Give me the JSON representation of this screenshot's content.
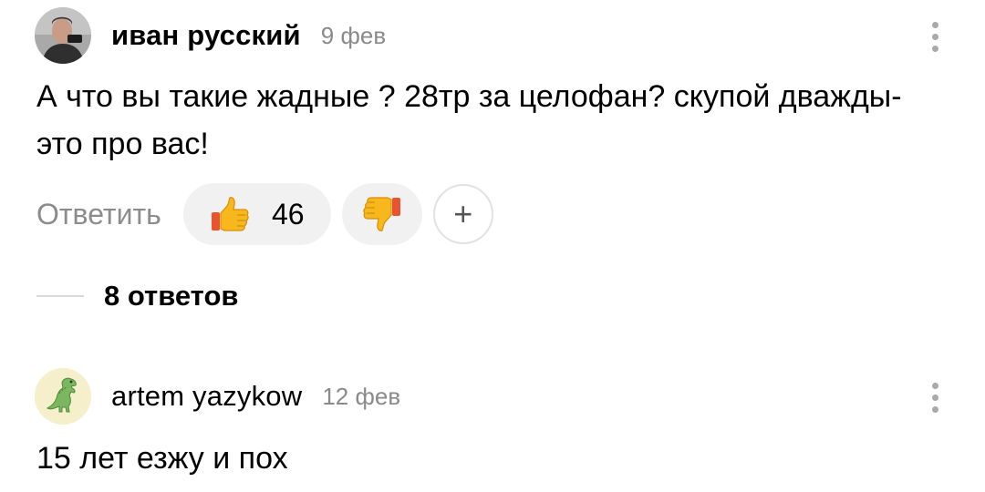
{
  "comments": [
    {
      "author": "иван русский",
      "date": "9 фев",
      "text": "А что вы такие жадные ? 28тр за целофан? скупой дважды-это про вас!",
      "reply_label": "Ответить",
      "likes": "46",
      "add_reaction_label": "+",
      "replies_label": "8 ответов",
      "avatar_icon": "user-photo-avatar",
      "like_icon": "thumbs-up-icon",
      "dislike_icon": "thumbs-down-icon"
    },
    {
      "author": "artem yazykow",
      "date": "12 фев",
      "text": "15 лет езжу и пох",
      "avatar_icon": "dinosaur-avatar"
    }
  ],
  "colors": {
    "muted_text": "#8a8a8a",
    "pill_background": "#f1f1f1",
    "avatar_background": "#f6efcc"
  }
}
